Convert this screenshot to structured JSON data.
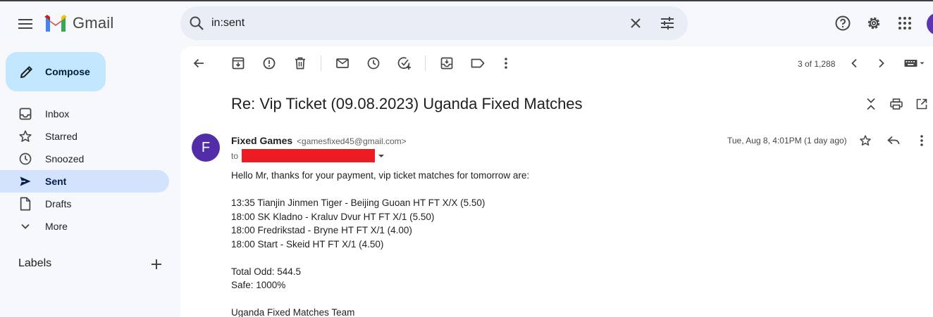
{
  "header": {
    "app_name": "Gmail",
    "search_value": "in:sent"
  },
  "sidebar": {
    "compose_label": "Compose",
    "items": [
      {
        "label": "Inbox"
      },
      {
        "label": "Starred"
      },
      {
        "label": "Snoozed"
      },
      {
        "label": "Sent",
        "active": true
      },
      {
        "label": "Drafts"
      },
      {
        "label": "More"
      }
    ],
    "labels_title": "Labels"
  },
  "toolbar": {
    "pager": "3 of 1,288"
  },
  "email": {
    "subject": "Re: Vip Ticket (09.08.2023) Uganda Fixed Matches",
    "sender_initial": "F",
    "sender_name": "Fixed Games",
    "sender_email": "<gamesfixed45@gmail.com>",
    "to_label": "to",
    "date": "Tue, Aug 8, 4:01PM (1 day ago)",
    "body": {
      "greeting": "Hello Mr, thanks for your payment, vip ticket matches for tomorrow are:",
      "matches": [
        "13:35 Tianjin Jinmen Tiger - Beijing Guoan HT FT X/X (5.50)",
        "18:00 SK Kladno - Kraluv Dvur HT FT X/1 (5.50)",
        "18:00 Fredrikstad - Bryne HT FT X/1 (4.00)",
        "18:00 Start - Skeid HT FT X/1 (4.50)"
      ],
      "total_odd": "Total Odd: 544.5",
      "safe": "Safe: 1000%",
      "signature": "Uganda Fixed Matches Team"
    }
  },
  "colors": {
    "compose_bg": "#c2e7ff",
    "active_nav_bg": "#d3e3fd",
    "avatar_bg": "#512da8",
    "redaction": "#ed1c24"
  }
}
